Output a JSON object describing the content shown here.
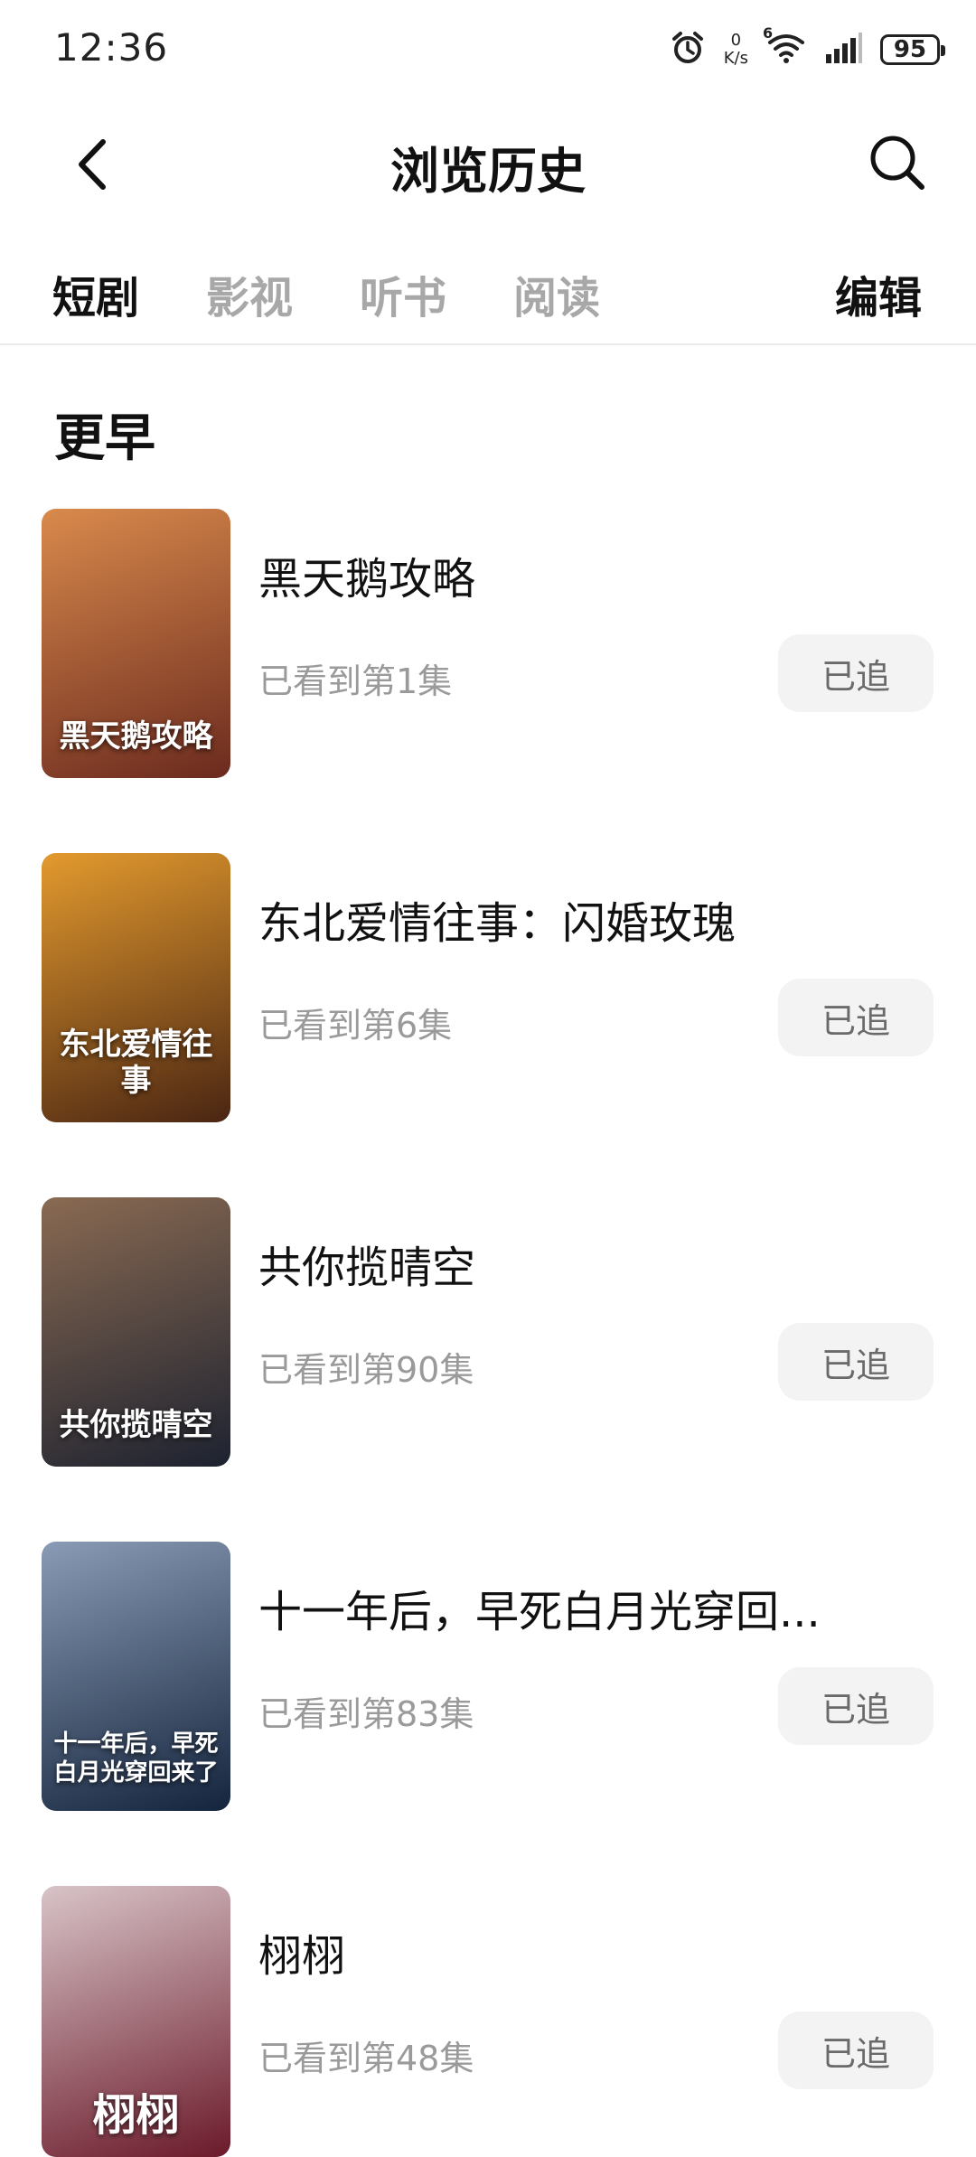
{
  "status": {
    "time": "12:36",
    "net_speed_value": "0",
    "net_speed_unit": "K/s",
    "network_type": "6",
    "battery": "95"
  },
  "header": {
    "title": "浏览历史",
    "back_icon": "chevron-left-icon",
    "search_icon": "search-icon"
  },
  "tabs": [
    {
      "label": "短剧",
      "active": true
    },
    {
      "label": "影视",
      "active": false
    },
    {
      "label": "听书",
      "active": false
    },
    {
      "label": "阅读",
      "active": false
    }
  ],
  "edit_label": "编辑",
  "section_title": "更早",
  "items": [
    {
      "title": "黑天鹅攻略",
      "progress": "已看到第1集",
      "button": "已追",
      "poster_text": "黑天鹅攻略",
      "colors": [
        "#6b2a1e",
        "#d98a4c"
      ]
    },
    {
      "title": "东北爱情往事：闪婚玫瑰",
      "progress": "已看到第6集",
      "button": "已追",
      "poster_text": "东北爱情往事",
      "colors": [
        "#4a2512",
        "#e39a2e"
      ]
    },
    {
      "title": "共你揽晴空",
      "progress": "已看到第90集",
      "button": "已追",
      "poster_text": "共你揽晴空",
      "colors": [
        "#1d2230",
        "#8a6a52"
      ]
    },
    {
      "title": "十一年后，早死白月光穿回...",
      "progress": "已看到第83集",
      "button": "已追",
      "poster_text": "十一年后，早死白月光穿回来了",
      "colors": [
        "#14243d",
        "#8a9bb5"
      ]
    },
    {
      "title": "栩栩",
      "progress": "已看到第48集",
      "button": "已追",
      "poster_text": "栩栩",
      "colors": [
        "#6b1a2a",
        "#d8c4c8"
      ]
    }
  ]
}
